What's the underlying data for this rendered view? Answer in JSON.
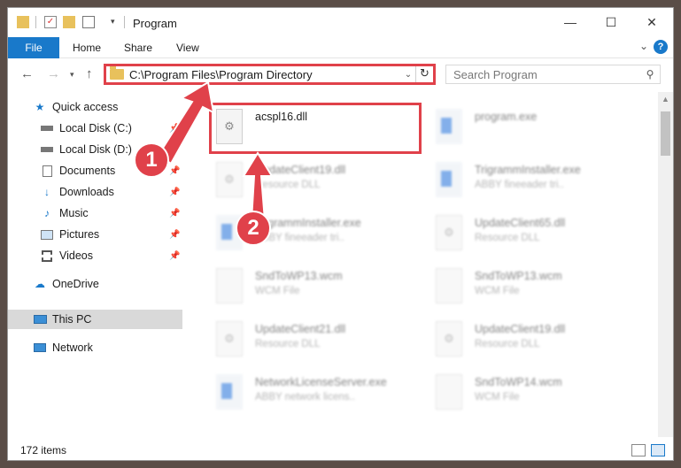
{
  "window": {
    "title": "Program",
    "ribbon_tabs": [
      "File",
      "Home",
      "Share",
      "View"
    ],
    "address_path": "C:\\Program Files\\Program Directory",
    "search_placeholder": "Search Program"
  },
  "sidebar": {
    "items": [
      {
        "label": "Quick access",
        "icon": "star-icon",
        "pinned": false,
        "selected": false
      },
      {
        "label": "Local Disk (C:)",
        "icon": "drive-icon",
        "pinned": true,
        "selected": false
      },
      {
        "label": "Local Disk (D:)",
        "icon": "drive-icon",
        "pinned": true,
        "selected": false
      },
      {
        "label": "Documents",
        "icon": "documents-icon",
        "pinned": true,
        "selected": false
      },
      {
        "label": "Downloads",
        "icon": "download-icon",
        "pinned": true,
        "selected": false
      },
      {
        "label": "Music",
        "icon": "music-icon",
        "pinned": true,
        "selected": false
      },
      {
        "label": "Pictures",
        "icon": "pictures-icon",
        "pinned": true,
        "selected": false
      },
      {
        "label": "Videos",
        "icon": "videos-icon",
        "pinned": true,
        "selected": false
      },
      {
        "label": "OneDrive",
        "icon": "cloud-icon",
        "pinned": false,
        "selected": false
      },
      {
        "label": "This PC",
        "icon": "computer-icon",
        "pinned": false,
        "selected": true
      },
      {
        "label": "Network",
        "icon": "network-icon",
        "pinned": false,
        "selected": false
      }
    ]
  },
  "files": [
    {
      "name": "acspl16.dll",
      "type": "",
      "kind": "dll",
      "highlighted": true
    },
    {
      "name": "program.exe",
      "type": "",
      "kind": "exe",
      "highlighted": false
    },
    {
      "name": "UpdateClient19.dll",
      "type": "Resource DLL",
      "kind": "dll",
      "highlighted": false
    },
    {
      "name": "TrigrammInstaller.exe",
      "type": "ABBY fineeader tri..",
      "kind": "exe",
      "highlighted": false
    },
    {
      "name": "TrigrammInstaller.exe",
      "type": "ABBY fineeader tri..",
      "kind": "exe",
      "highlighted": false
    },
    {
      "name": "UpdateClient65.dll",
      "type": "Resource DLL",
      "kind": "dll",
      "highlighted": false
    },
    {
      "name": "SndToWP13.wcm",
      "type": "WCM File",
      "kind": "file",
      "highlighted": false
    },
    {
      "name": "SndToWP13.wcm",
      "type": "WCM File",
      "kind": "file",
      "highlighted": false
    },
    {
      "name": "UpdateClient21.dll",
      "type": "Resource DLL",
      "kind": "dll",
      "highlighted": false
    },
    {
      "name": "UpdateClient19.dll",
      "type": "Resource DLL",
      "kind": "dll",
      "highlighted": false
    },
    {
      "name": "NetworkLicenseServer.exe",
      "type": "ABBY network licens..",
      "kind": "exe",
      "highlighted": false
    },
    {
      "name": "SndToWP14.wcm",
      "type": "WCM File",
      "kind": "file",
      "highlighted": false
    }
  ],
  "status": {
    "item_count": "172 items"
  },
  "annotations": {
    "step1": "1",
    "step2": "2",
    "color": "#e0414a"
  },
  "colors": {
    "accent": "#1979ca",
    "annotation": "#e0414a",
    "selection": "#d9d9d9"
  }
}
